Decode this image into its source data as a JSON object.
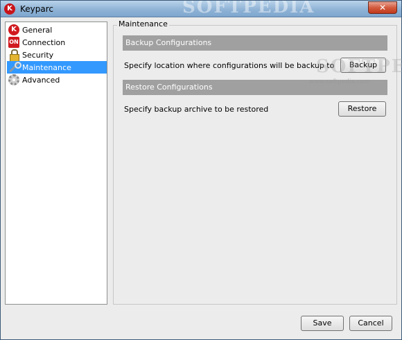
{
  "window": {
    "title": "Keyparc",
    "close_label": "✕",
    "watermark": "SOFTPEDIA"
  },
  "sidebar": {
    "items": [
      {
        "label": "General",
        "icon": "k-logo-icon"
      },
      {
        "label": "Connection",
        "icon": "connection-icon"
      },
      {
        "label": "Security",
        "icon": "lock-icon"
      },
      {
        "label": "Maintenance",
        "icon": "wrench-icon",
        "selected": true
      },
      {
        "label": "Advanced",
        "icon": "gear-icon"
      }
    ]
  },
  "panel": {
    "title": "Maintenance",
    "backup": {
      "header": "Backup Configurations",
      "label": "Specify location where configurations will be backup to",
      "button": "Backup"
    },
    "restore": {
      "header": "Restore Configurations",
      "label": "Specify backup archive to be restored",
      "button": "Restore"
    },
    "watermark_logo": "SOFTPEDIA",
    "watermark_url": "www.softpedia.com"
  },
  "footer": {
    "save": "Save",
    "cancel": "Cancel"
  },
  "colors": {
    "selection": "#3399ff",
    "section_header": "#a0a0a0"
  }
}
